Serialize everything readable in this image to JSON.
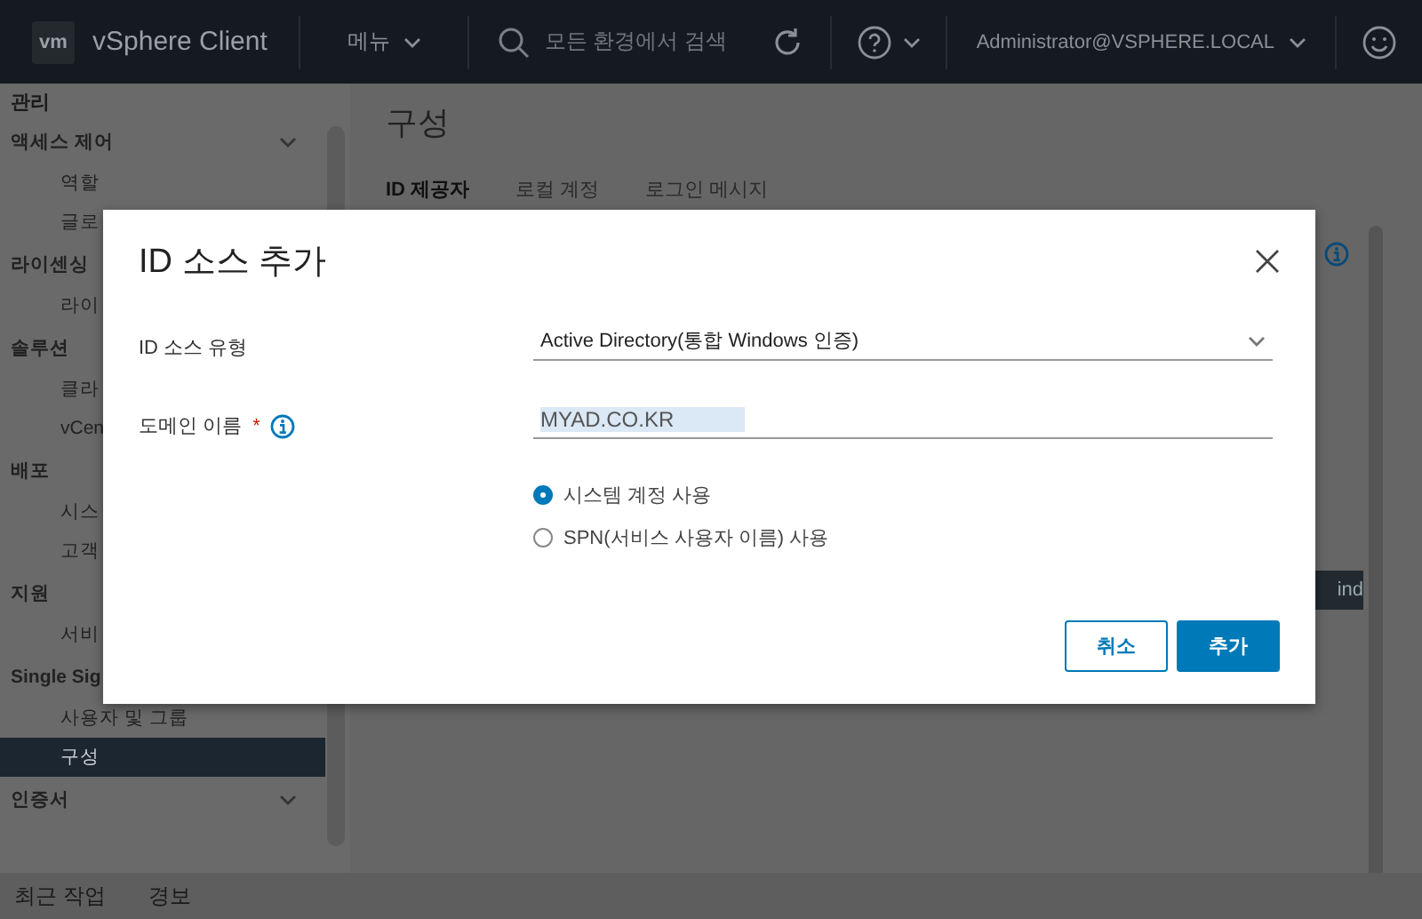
{
  "header": {
    "logo": "vm",
    "product": "vSphere Client",
    "menu": "메뉴",
    "search_placeholder": "모든 환경에서 검색",
    "user": "Administrator@VSPHERE.LOCAL"
  },
  "sidebar": {
    "title": "관리",
    "groups": [
      {
        "label": "액세스 제어",
        "expanded": true,
        "children": [
          {
            "label": "역할",
            "selected": false
          },
          {
            "label": "글로",
            "selected": false
          }
        ]
      },
      {
        "label": "라이센싱",
        "expanded": true,
        "children": [
          {
            "label": "라이",
            "selected": false
          }
        ]
      },
      {
        "label": "솔루션",
        "expanded": true,
        "children": [
          {
            "label": "클라",
            "selected": false
          },
          {
            "label": "vCen",
            "selected": false
          }
        ]
      },
      {
        "label": "배포",
        "expanded": true,
        "children": [
          {
            "label": "시스",
            "selected": false
          },
          {
            "label": "고객",
            "selected": false
          }
        ]
      },
      {
        "label": "지원",
        "expanded": true,
        "children": [
          {
            "label": "서비",
            "selected": false
          }
        ]
      },
      {
        "label": "Single Sig",
        "expanded": true,
        "children": [
          {
            "label": "사용자 및 그룹",
            "selected": false
          },
          {
            "label": "구성",
            "selected": true
          }
        ]
      },
      {
        "label": "인증서",
        "expanded": true
      }
    ]
  },
  "main": {
    "title": "구성",
    "tabs": [
      {
        "label": "ID 제공자",
        "selected": true
      },
      {
        "label": "로컬 계정",
        "selected": false
      },
      {
        "label": "로그인 메시지",
        "selected": false
      }
    ],
    "side_button": "ind"
  },
  "dialog": {
    "title": "ID 소스 추가",
    "fields": [
      {
        "kind": "select",
        "label": "ID 소스 유형",
        "value": "Active Directory(통합 Windows 인증)",
        "info": false
      },
      {
        "kind": "text",
        "label": "도메인 이름",
        "value": "MYAD.CO.KR",
        "required_mark": "*",
        "info": true
      }
    ],
    "options": [
      {
        "label": "시스템 계정 사용",
        "selected": true
      },
      {
        "label": "SPN(서비스 사용자 이름) 사용",
        "selected": false
      }
    ],
    "buttons": [
      {
        "label": "취소",
        "kind": "secondary"
      },
      {
        "label": "추가",
        "kind": "primary"
      }
    ]
  },
  "bottom_bar": {
    "tabs": [
      "최근 작업",
      "경보"
    ]
  }
}
